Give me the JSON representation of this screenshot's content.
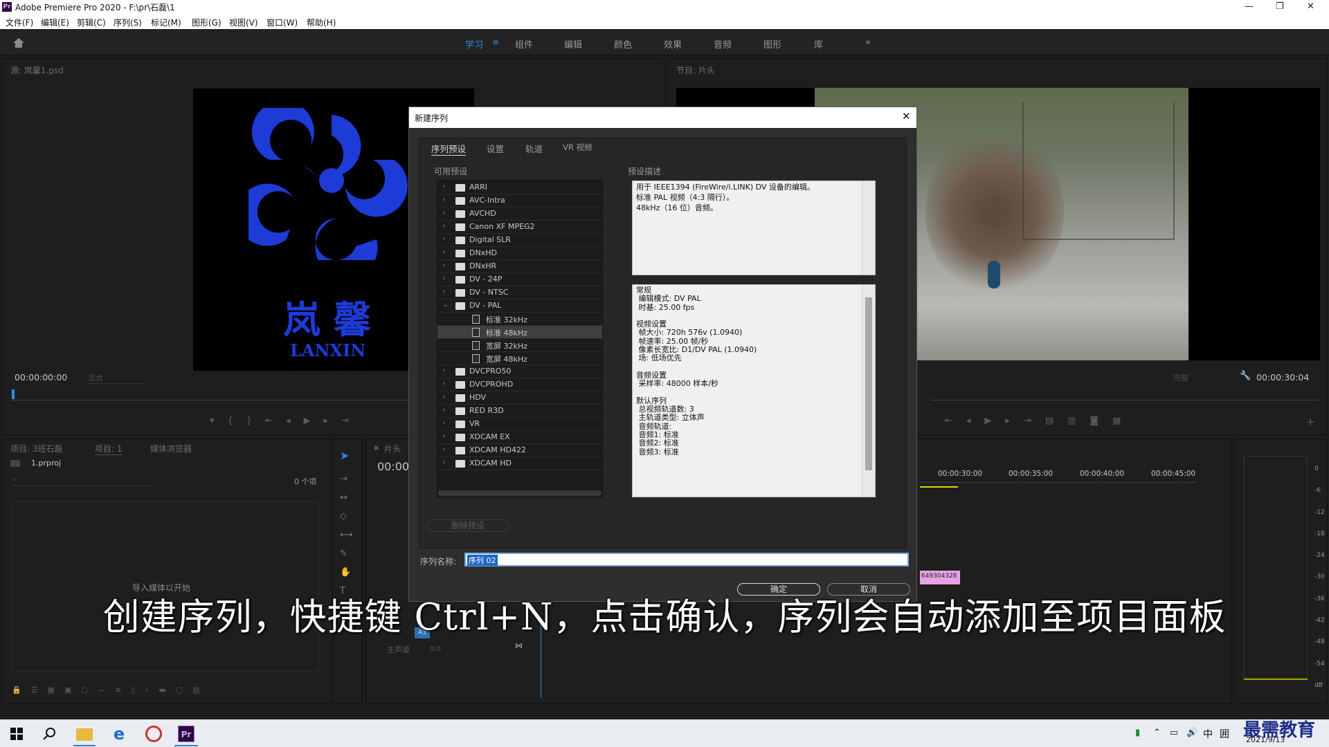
{
  "window": {
    "app_badge": "Pr",
    "title": "Adobe Premiere Pro 2020 - F:\\pr\\石磊\\1"
  },
  "menu": [
    "文件(F)",
    "编辑(E)",
    "剪辑(C)",
    "序列(S)",
    "标记(M)",
    "图形(G)",
    "视图(V)",
    "窗口(W)",
    "帮助(H)"
  ],
  "workspaces": [
    {
      "label": "学习",
      "active": true
    },
    {
      "label": "组件"
    },
    {
      "label": "编辑"
    },
    {
      "label": "颜色"
    },
    {
      "label": "效果"
    },
    {
      "label": "音频"
    },
    {
      "label": "图形"
    },
    {
      "label": "库"
    }
  ],
  "source_panel": {
    "title": "源: 岚馨1.psd",
    "logo_text": "岚 馨",
    "logo_sub": "LANXIN",
    "timecode": "00:00:00:00",
    "fit": "适合"
  },
  "program_panel": {
    "title": "节目: 片头",
    "timecode": "00:00:30:04",
    "quality": "完整"
  },
  "project_panel": {
    "tabs": [
      "项目: 3班石磊",
      "项目: 1",
      "媒体浏览器"
    ],
    "file": "1.prproj",
    "count": "0 个项",
    "empty_text": "导入媒体以开始"
  },
  "timeline": {
    "tab": "片头",
    "timecode": "00:00",
    "ruler": [
      "00:00:30:00",
      "00:00:35:00",
      "00:00:40:00",
      "00:00:45:00"
    ],
    "track": "A3",
    "master": "主声道",
    "master_val": "0.0",
    "clip": "649304328"
  },
  "meter": [
    "0",
    "-6",
    "-12",
    "-18",
    "-24",
    "-30",
    "-36",
    "-42",
    "-48",
    "-54",
    "dB"
  ],
  "dialog": {
    "title": "新建序列",
    "tabs": [
      "序列预设",
      "设置",
      "轨道",
      "VR 视频"
    ],
    "available_label": "可用预设",
    "desc_label": "预设描述",
    "presets": [
      {
        "label": "ARRI",
        "kind": "folder"
      },
      {
        "label": "AVC-Intra",
        "kind": "folder"
      },
      {
        "label": "AVCHD",
        "kind": "folder"
      },
      {
        "label": "Canon XF MPEG2",
        "kind": "folder"
      },
      {
        "label": "Digital SLR",
        "kind": "folder"
      },
      {
        "label": "DNxHD",
        "kind": "folder"
      },
      {
        "label": "DNxHR",
        "kind": "folder"
      },
      {
        "label": "DV - 24P",
        "kind": "folder"
      },
      {
        "label": "DV - NTSC",
        "kind": "folder"
      },
      {
        "label": "DV - PAL",
        "kind": "folder",
        "open": true
      },
      {
        "label": "标准 32kHz",
        "kind": "file"
      },
      {
        "label": "标准 48kHz",
        "kind": "file",
        "selected": true
      },
      {
        "label": "宽屏 32kHz",
        "kind": "file"
      },
      {
        "label": "宽屏 48kHz",
        "kind": "file"
      },
      {
        "label": "DVCPRO50",
        "kind": "folder"
      },
      {
        "label": "DVCPROHD",
        "kind": "folder"
      },
      {
        "label": "HDV",
        "kind": "folder"
      },
      {
        "label": "RED R3D",
        "kind": "folder"
      },
      {
        "label": "VR",
        "kind": "folder"
      },
      {
        "label": "XDCAM EX",
        "kind": "folder"
      },
      {
        "label": "XDCAM HD422",
        "kind": "folder"
      },
      {
        "label": "XDCAM HD",
        "kind": "folder"
      }
    ],
    "description": [
      "用于 IEEE1394 (FireWire/i.LINK) DV 设备的编辑。",
      "标准 PAL 视频（4:3 隔行）。",
      "48kHz（16 位）音频。"
    ],
    "info": [
      "常规",
      " 编辑模式: DV PAL",
      " 时基: 25.00 fps",
      "",
      "视频设置",
      " 帧大小: 720h 576v (1.0940)",
      " 帧速率: 25.00 帧/秒",
      " 像素长宽比: D1/DV PAL (1.0940)",
      " 场: 低场优先",
      "",
      "音频设置",
      " 采样率: 48000 样本/秒",
      "",
      "默认序列",
      " 总视频轨道数: 3",
      " 主轨道类型: 立体声",
      " 音频轨道:",
      " 音频1: 标准",
      " 音频2: 标准",
      " 音频3: 标准"
    ],
    "delete_preset": "删除预设",
    "name_label": "序列名称:",
    "name_value": "序列 02",
    "ok": "确定",
    "cancel": "取消"
  },
  "subtitle": "创建序列，快捷键 Ctrl+N，点击确认，序列会自动添加至项目面板",
  "taskbar": {
    "ime": "中",
    "grid": "囲",
    "date": "2021/9/13",
    "watermark": "最需教育"
  }
}
